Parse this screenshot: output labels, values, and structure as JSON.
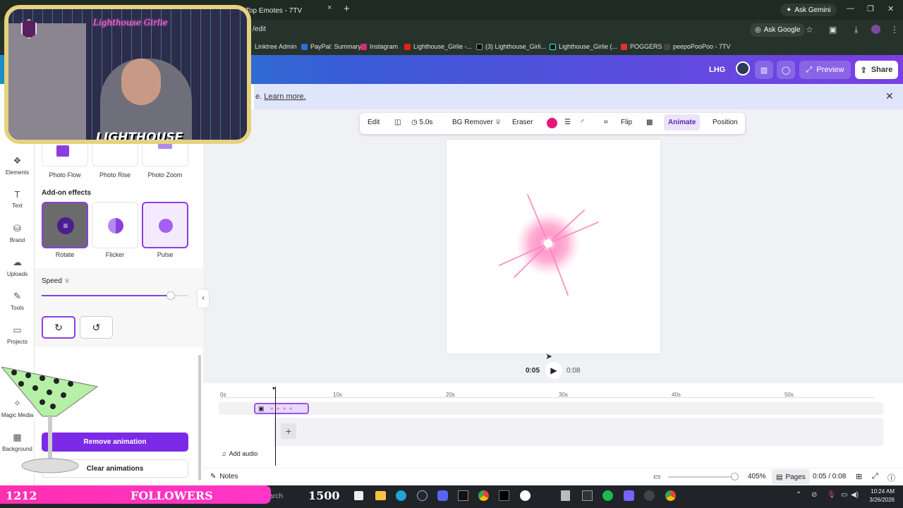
{
  "browser": {
    "tab_title": "Top Emotes - 7TV",
    "tab_close": "×",
    "new_tab": "+",
    "ask_gemini": "Ask Gemini",
    "url_fragment": "/edit",
    "ask_google": "Ask Google",
    "bookmarks": [
      "Linktree Admin",
      "PayPal: Summary",
      "Instagram",
      "Lighthouse_Girlie -...",
      "(3) Lighthouse_Girli...",
      "Lighthouse_Girlie (...",
      "POGGERS",
      "peepoPooPoo - 7TV"
    ]
  },
  "header": {
    "team": "LHG",
    "preview": "Preview",
    "share": "Share"
  },
  "infobar": {
    "text_prefix": "e.",
    "learn_more": "Learn more."
  },
  "rail": [
    {
      "label": "Elements",
      "icon": "elements-icon"
    },
    {
      "label": "Text",
      "icon": "text-icon"
    },
    {
      "label": "Brand",
      "icon": "brand-icon"
    },
    {
      "label": "Uploads",
      "icon": "uploads-icon"
    },
    {
      "label": "Tools",
      "icon": "tools-icon"
    },
    {
      "label": "Projects",
      "icon": "projects-icon"
    },
    {
      "label": "Magic Media",
      "icon": "magic-media-icon"
    },
    {
      "label": "Background",
      "icon": "background-icon"
    }
  ],
  "panel": {
    "photo_effects": [
      "Photo Flow",
      "Photo Rise",
      "Photo Zoom"
    ],
    "addon_heading": "Add-on effects",
    "addon_effects": [
      "Rotate",
      "Flicker",
      "Pulse"
    ],
    "speed_label": "Speed",
    "speed_value": 0.88,
    "remove_animation": "Remove animation",
    "clear_animations": "Clear animations"
  },
  "toolbar": {
    "edit": "Edit",
    "duration": "5.0s",
    "bg_remover": "BG Remover",
    "eraser": "Eraser",
    "flip": "Flip",
    "animate": "Animate",
    "position": "Position",
    "color": "#e6177a"
  },
  "playback": {
    "current": "0:05",
    "total": "0:08"
  },
  "timeline": {
    "ticks": [
      "0s",
      "10s",
      "20s",
      "30s",
      "40s",
      "50s"
    ],
    "add_audio": "Add audio"
  },
  "bottombar": {
    "notes": "Notes",
    "zoom": "405%",
    "pages": "Pages",
    "time": "0:05 / 0:08"
  },
  "overlay": {
    "followers_count": "1212",
    "followers_label": "FOLLOWERS",
    "followers_goal": "1500",
    "webcam_title": "Lighthouse Girlie",
    "logo_text": "LIGHTHOUSE"
  },
  "taskbar": {
    "search": "earch",
    "time": "10:24 AM",
    "date": "3/26/2026"
  }
}
